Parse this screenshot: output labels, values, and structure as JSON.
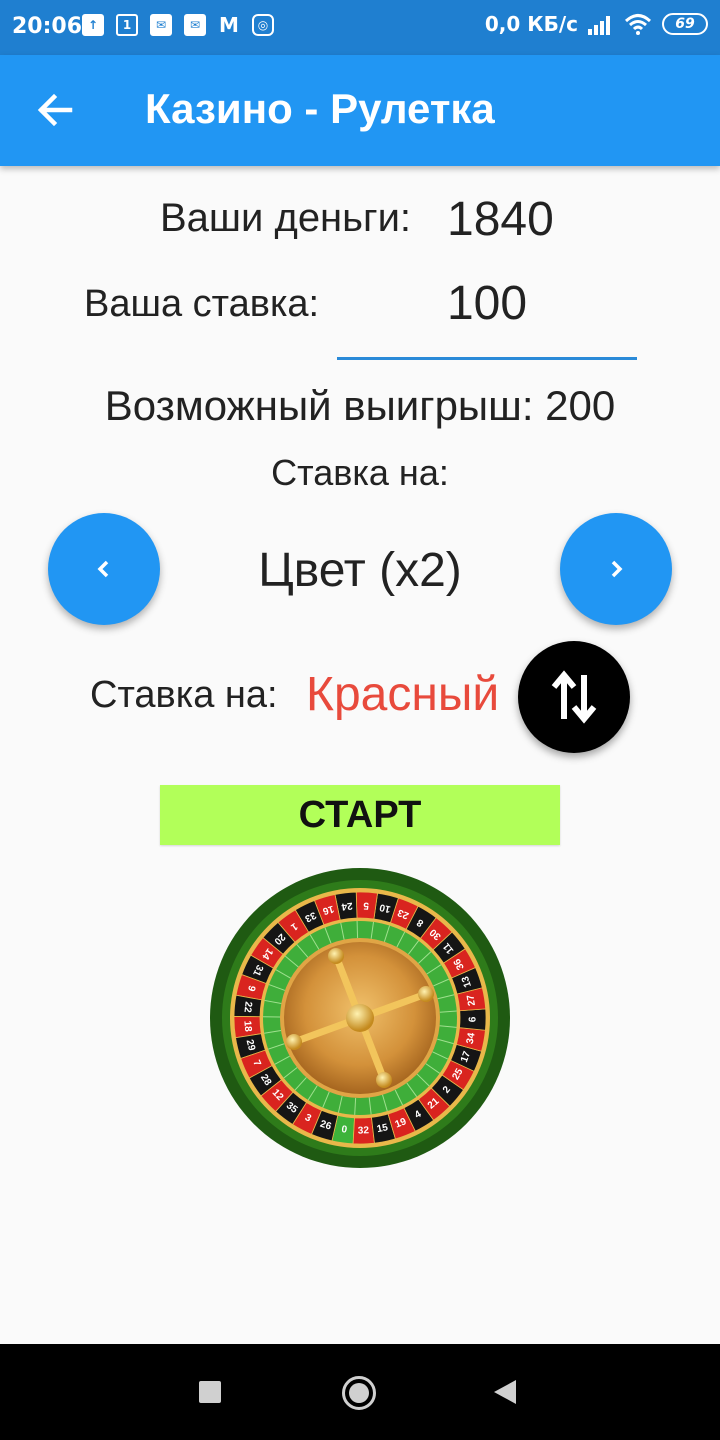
{
  "status_bar": {
    "time": "20:06",
    "notif_icons": [
      "upload-icon",
      "sim-1-icon",
      "mail-icon",
      "mail-icon",
      "gmail-icon",
      "instagram-icon"
    ],
    "sim_number": "1",
    "network_speed": "0,0 КБ/с",
    "battery": "69"
  },
  "app_bar": {
    "title": "Казино - Рулетка",
    "back_icon": "arrow-back-icon",
    "color": "#2196f3"
  },
  "form": {
    "money_label": "Ваши деньги:",
    "money_value": "1840",
    "bet_label": "Ваша ставка:",
    "bet_value": "100",
    "win_text": "Возможный выигрыш: 200",
    "bet_on_label": "Ставка на:",
    "bet_type": "Цвет (x2)",
    "bet_on_label_2": "Ставка на:",
    "bet_color": "Красный",
    "bet_color_hex": "#e84a3c",
    "start_label": "СТАРТ",
    "start_color": "#b2ff59"
  },
  "roulette": {
    "numbers": [
      "0",
      "32",
      "15",
      "19",
      "4",
      "21",
      "2",
      "25",
      "17",
      "34",
      "6",
      "27",
      "13",
      "36",
      "11",
      "30",
      "8",
      "23",
      "10",
      "5",
      "24",
      "16",
      "33",
      "1",
      "20",
      "14",
      "31",
      "9",
      "22",
      "18",
      "29",
      "7",
      "28",
      "12",
      "35",
      "3",
      "26"
    ]
  },
  "nav_bar": {
    "icons": [
      "recent-apps-icon",
      "home-icon",
      "back-icon"
    ]
  }
}
